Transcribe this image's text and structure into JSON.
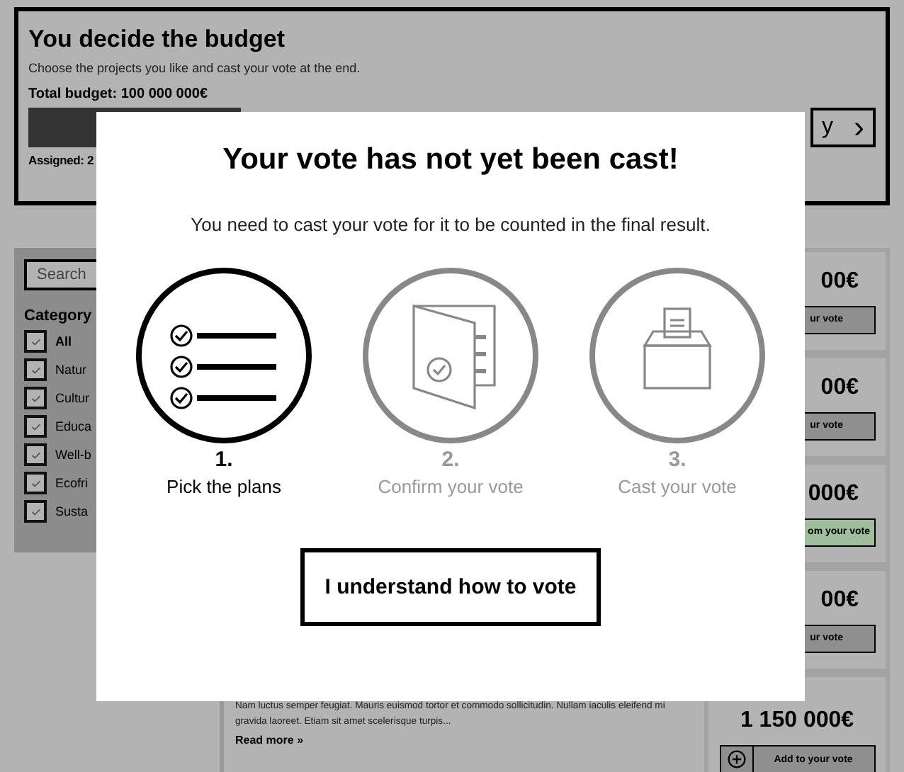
{
  "header": {
    "title": "You decide the budget",
    "subtitle": "Choose the projects you like and cast your vote at the end.",
    "total_budget": "Total budget: 100 000 000€",
    "assigned": "Assigned: 2",
    "summary_button": {
      "label": "y",
      "icon": "›"
    }
  },
  "sidebar": {
    "search": {
      "placeholder": "Search"
    },
    "category_title": "Category",
    "categories": [
      {
        "label": "All",
        "checked": true,
        "bold": true
      },
      {
        "label": "Natur",
        "checked": true,
        "bold": false
      },
      {
        "label": "Cultur",
        "checked": true,
        "bold": false
      },
      {
        "label": "Educa",
        "checked": true,
        "bold": false
      },
      {
        "label": "Well-b",
        "checked": true,
        "bold": false
      },
      {
        "label": "Ecofri",
        "checked": true,
        "bold": false
      },
      {
        "label": "Susta",
        "checked": true,
        "bold": false
      }
    ]
  },
  "project": {
    "text": "Nam luctus semper feugiat. Mauris euismod tortor et commodo sollicitudin. Nullam iaculis eleifend mi gravida laoreet. Etiam sit amet scelerisque turpis...",
    "read_more": "Read more »"
  },
  "prices": [
    {
      "price": "00€",
      "button": "ur vote",
      "in_vote": false,
      "icon": false
    },
    {
      "price": "00€",
      "button": "ur vote",
      "in_vote": false,
      "icon": false
    },
    {
      "price": "000€",
      "button": "om your vote",
      "in_vote": true,
      "icon": false
    },
    {
      "price": "00€",
      "button": "ur vote",
      "in_vote": false,
      "icon": false
    },
    {
      "price": "1 150 000€",
      "button": "Add to your vote",
      "in_vote": false,
      "icon": true
    }
  ],
  "modal": {
    "title": "Your vote has not yet been cast!",
    "text": "You need to cast your vote for it to be counted in the final result.",
    "steps": [
      {
        "kind": "list",
        "number": "1.",
        "label": "Pick the plans",
        "active": true
      },
      {
        "kind": "booklet",
        "number": "2.",
        "label": "Confirm your vote",
        "active": false
      },
      {
        "kind": "ballot",
        "number": "3.",
        "label": "Cast your vote",
        "active": false
      }
    ],
    "button": "I understand how to vote"
  }
}
